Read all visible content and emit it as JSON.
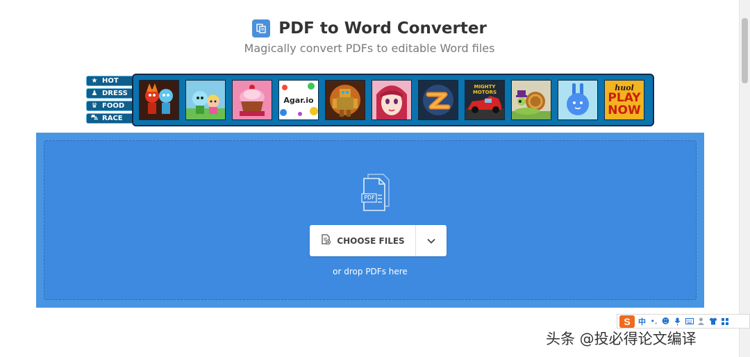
{
  "header": {
    "title": "PDF to Word Converter",
    "subtitle": "Magically convert PDFs to editable Word files",
    "icon": "document-convert-icon",
    "accent_color": "#4a90d9"
  },
  "games_banner": {
    "categories": [
      {
        "label": "HOT",
        "icon": "star-icon"
      },
      {
        "label": "DRESS",
        "icon": "person-icon"
      },
      {
        "label": "FOOD",
        "icon": "chef-hat-icon"
      },
      {
        "label": "RACE",
        "icon": "car-icon"
      }
    ],
    "games": [
      {
        "name": "fireboy-watergirl",
        "label": "",
        "bg": "#3a1b12"
      },
      {
        "name": "cartoon-kids",
        "label": "",
        "bg": "#7fc7e8"
      },
      {
        "name": "cupcake",
        "label": "",
        "bg": "#e86a9c"
      },
      {
        "name": "agar-io",
        "label": "Agar.io",
        "bg": "#ffffff"
      },
      {
        "name": "robot",
        "label": "",
        "bg": "#b35a1a"
      },
      {
        "name": "anime-girl",
        "label": "",
        "bg": "#e8a2b8"
      },
      {
        "name": "slither",
        "label": "",
        "bg": "#1b3a5e"
      },
      {
        "name": "mighty-motors",
        "label": "MIGHTY MOTORS",
        "bg": "#2a2a2a"
      },
      {
        "name": "snail",
        "label": "",
        "bg": "#e8e0c6"
      },
      {
        "name": "blue-bunny",
        "label": "",
        "bg": "#9fdcef"
      },
      {
        "name": "play-now",
        "label": "PLAY NOW",
        "bg": "#f4b320"
      }
    ],
    "play_now_brand": "huol"
  },
  "upload": {
    "panel_color": "#4a95e2",
    "choose_files_label": "CHOOSE FILES",
    "drop_hint": "or drop PDFs here",
    "pdf_badge": "PDF"
  },
  "ime_toolbar": {
    "logo": "S",
    "items": [
      {
        "label": "中",
        "icon": "chinese-mode-icon"
      },
      {
        "label": "•,",
        "icon": "punctuation-icon"
      },
      {
        "label": "☻",
        "icon": "emoji-icon"
      },
      {
        "label": "🎙",
        "icon": "microphone-icon"
      },
      {
        "label": "⌨",
        "icon": "keyboard-icon"
      },
      {
        "label": "👤",
        "icon": "user-icon"
      },
      {
        "label": "👕",
        "icon": "skin-icon"
      },
      {
        "label": "▦",
        "icon": "grid-icon"
      }
    ]
  },
  "watermark": {
    "text": "头条 @投必得论文编译"
  }
}
